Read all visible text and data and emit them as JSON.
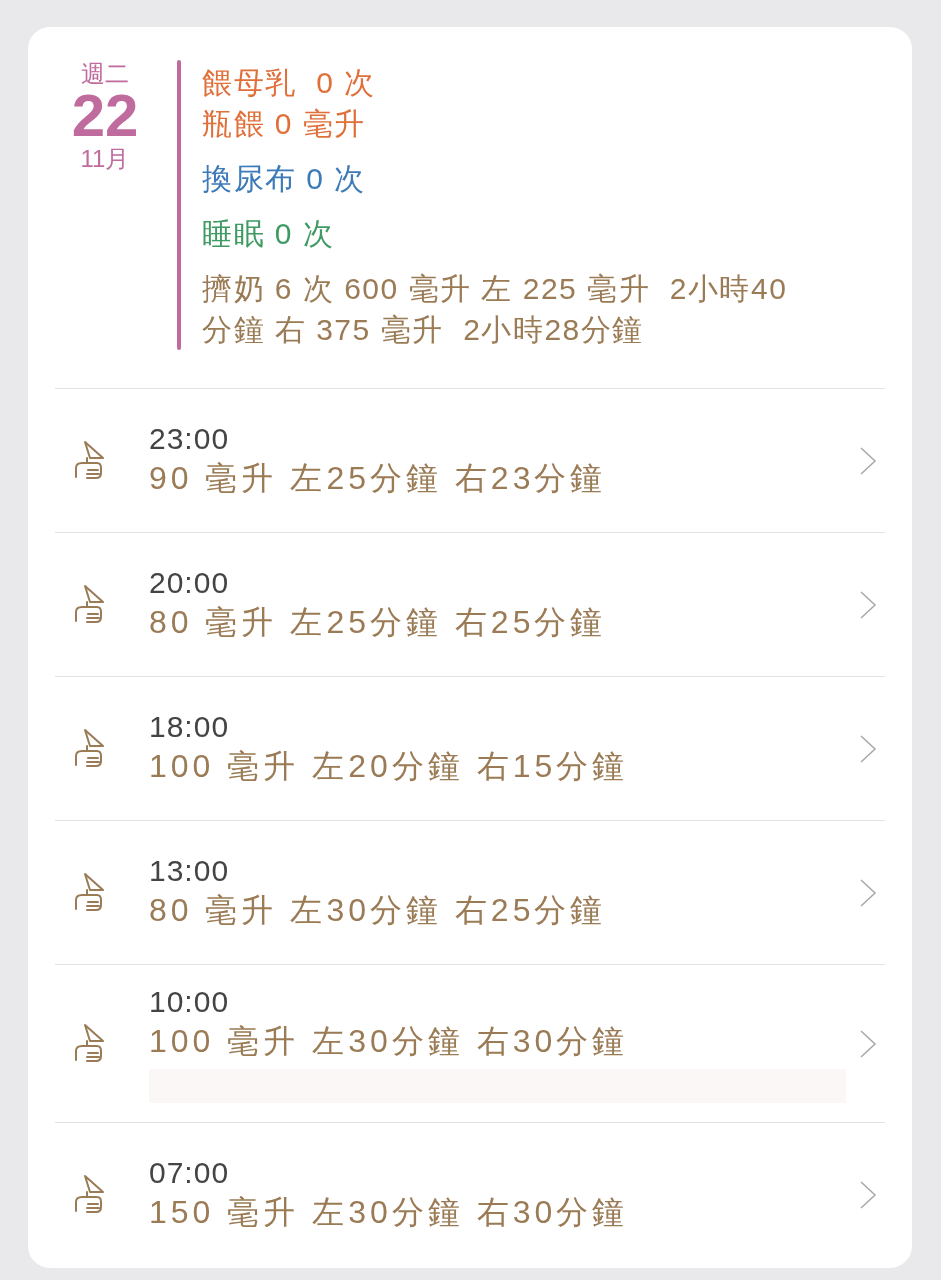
{
  "day": {
    "weekday": "週二",
    "date": "22",
    "month": "11月"
  },
  "summary": [
    {
      "color": "#e0703a",
      "lines": [
        "餵母乳  0 次",
        "瓶餵 0 毫升"
      ]
    },
    {
      "color": "#3d7ab8",
      "lines": [
        "換尿布 0 次"
      ]
    },
    {
      "color": "#3f9a63",
      "lines": [
        "睡眠 0 次"
      ]
    },
    {
      "color": "#9a7b55",
      "lines": [
        "擠奶 6 次 600 毫升 左 225 毫升  2小時40分鐘 右 375 毫升  2小時28分鐘"
      ]
    }
  ],
  "entries": [
    {
      "time": "23:00",
      "detail": "90 毫升 左25分鐘 右23分鐘",
      "note_area": false
    },
    {
      "time": "20:00",
      "detail": "80 毫升 左25分鐘 右25分鐘",
      "note_area": false
    },
    {
      "time": "18:00",
      "detail": "100 毫升 左20分鐘 右15分鐘",
      "note_area": false
    },
    {
      "time": "13:00",
      "detail": "80 毫升 左30分鐘 右25分鐘",
      "note_area": false
    },
    {
      "time": "10:00",
      "detail": "100 毫升 左30分鐘 右30分鐘",
      "note_area": true
    },
    {
      "time": "07:00",
      "detail": "150 毫升 左30分鐘 右30分鐘",
      "note_area": false
    }
  ]
}
